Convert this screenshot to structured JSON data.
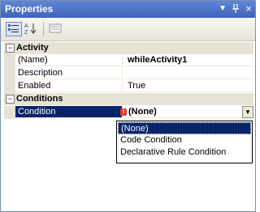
{
  "window": {
    "title": "Properties",
    "pin_glyph": "▼",
    "pushpin_glyph": "📌",
    "close_glyph": "×"
  },
  "toolbar": {
    "categorized_icon": "categorized-icon",
    "alphabetical_icon": "alphabetical-icon",
    "property_pages_icon": "property-pages-icon",
    "alphabetical_label": "AZ"
  },
  "categories": [
    {
      "label": "Activity",
      "toggle": "−"
    },
    {
      "label": "Conditions",
      "toggle": "−"
    }
  ],
  "rows": [
    {
      "name": "(Name)",
      "value": "whileActivity1",
      "bold": true
    },
    {
      "name": "Description",
      "value": ""
    },
    {
      "name": "Enabled",
      "value": "True"
    },
    {
      "name": "Condition",
      "value": "(None)",
      "bold": true,
      "selected": true
    }
  ],
  "dropdown": {
    "options": [
      "(None)",
      "Code Condition",
      "Declarative Rule Condition"
    ],
    "selected": "(None)"
  },
  "colors": {
    "titlebar": "#4a72c8",
    "selection": "#0a246a",
    "category_bg": "#e6e2d6"
  }
}
